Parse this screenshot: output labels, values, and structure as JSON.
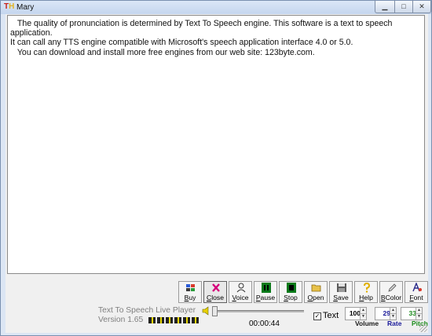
{
  "window": {
    "title": "Mary",
    "minimize_glyph": "▁",
    "maximize_glyph": "□",
    "close_glyph": "✕"
  },
  "editor": {
    "text": "   The quality of pronunciation is determined by Text To Speech engine. This software is a text to speech application.\nIt can call any TTS engine compatible with Microsoft's speech application interface 4.0 or 5.0.\n   You can download and install more free engines from our web site: 123byte.com."
  },
  "toolbar": {
    "buttons": [
      {
        "name": "buy-button",
        "icon": "cards-icon",
        "label": "Buy",
        "underline": "B",
        "rest": "uy"
      },
      {
        "name": "close-button",
        "icon": "x-icon",
        "label": "Close",
        "underline": "C",
        "rest": "lose",
        "active": true
      },
      {
        "name": "voice-button",
        "icon": "speaker-person-icon",
        "label": "Voice",
        "underline": "V",
        "rest": "oice"
      },
      {
        "name": "pause-button",
        "icon": "pause-icon",
        "label": "Pause",
        "underline": "P",
        "rest": "ause"
      },
      {
        "name": "stop-button",
        "icon": "stop-icon",
        "label": "Stop",
        "underline": "S",
        "rest": "top"
      },
      {
        "name": "open-button",
        "icon": "folder-icon",
        "label": "Open",
        "underline": "O",
        "rest": "pen"
      },
      {
        "name": "save-button",
        "icon": "floppy-icon",
        "label": "Save",
        "underline": "S",
        "rest": "ave"
      },
      {
        "name": "help-button",
        "icon": "help-icon",
        "label": "Help",
        "underline": "H",
        "rest": "elp"
      },
      {
        "name": "bcolor-button",
        "icon": "pencil-icon",
        "label": "BColor",
        "underline": "B",
        "rest": "Color"
      },
      {
        "name": "font-button",
        "icon": "font-icon",
        "label": "Font",
        "underline": "F",
        "rest": "ont"
      }
    ]
  },
  "player": {
    "name": "Text To Speech Live Player",
    "version": "Version 1.65",
    "time": "00:00:44",
    "text_checkbox_label": "Text",
    "text_checked": true,
    "check_glyph": "✓",
    "up_arrow": "▲",
    "down_arrow": "▼"
  },
  "controls": {
    "volume": {
      "value": "100",
      "label": "Volume",
      "color": "#1a1a1a"
    },
    "rate": {
      "value": "29",
      "label": "Rate",
      "color": "#1b1b9a"
    },
    "pitch": {
      "value": "33",
      "label": "Pitch",
      "color": "#1a8a1a"
    }
  }
}
